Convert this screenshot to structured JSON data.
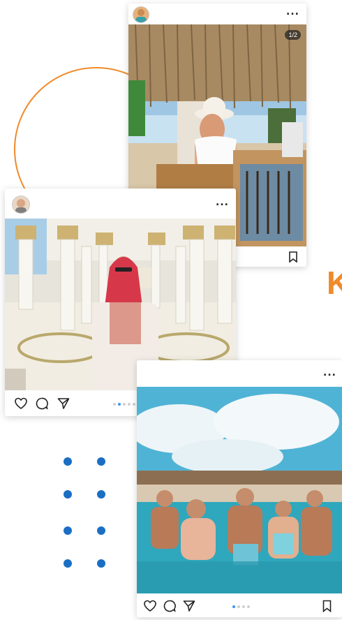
{
  "decor": {
    "accent_color": "#f08a2a",
    "dot_color": "#1a6fc4",
    "partial_letter": "K"
  },
  "posts": [
    {
      "id": "beach-post",
      "more_label": "...",
      "carousel_counter": "1/2",
      "icons": [
        "avatar",
        "more-icon",
        "bookmark-icon"
      ]
    },
    {
      "id": "mosque-post",
      "more_label": "...",
      "icons": [
        "avatar",
        "heart-icon",
        "comment-icon",
        "share-icon",
        "bookmark-icon"
      ],
      "pager_active": 1
    },
    {
      "id": "pool-post",
      "more_label": "...",
      "icons": [
        "heart-icon",
        "comment-icon",
        "share-icon",
        "bookmark-icon"
      ],
      "pager_active": 0
    }
  ]
}
